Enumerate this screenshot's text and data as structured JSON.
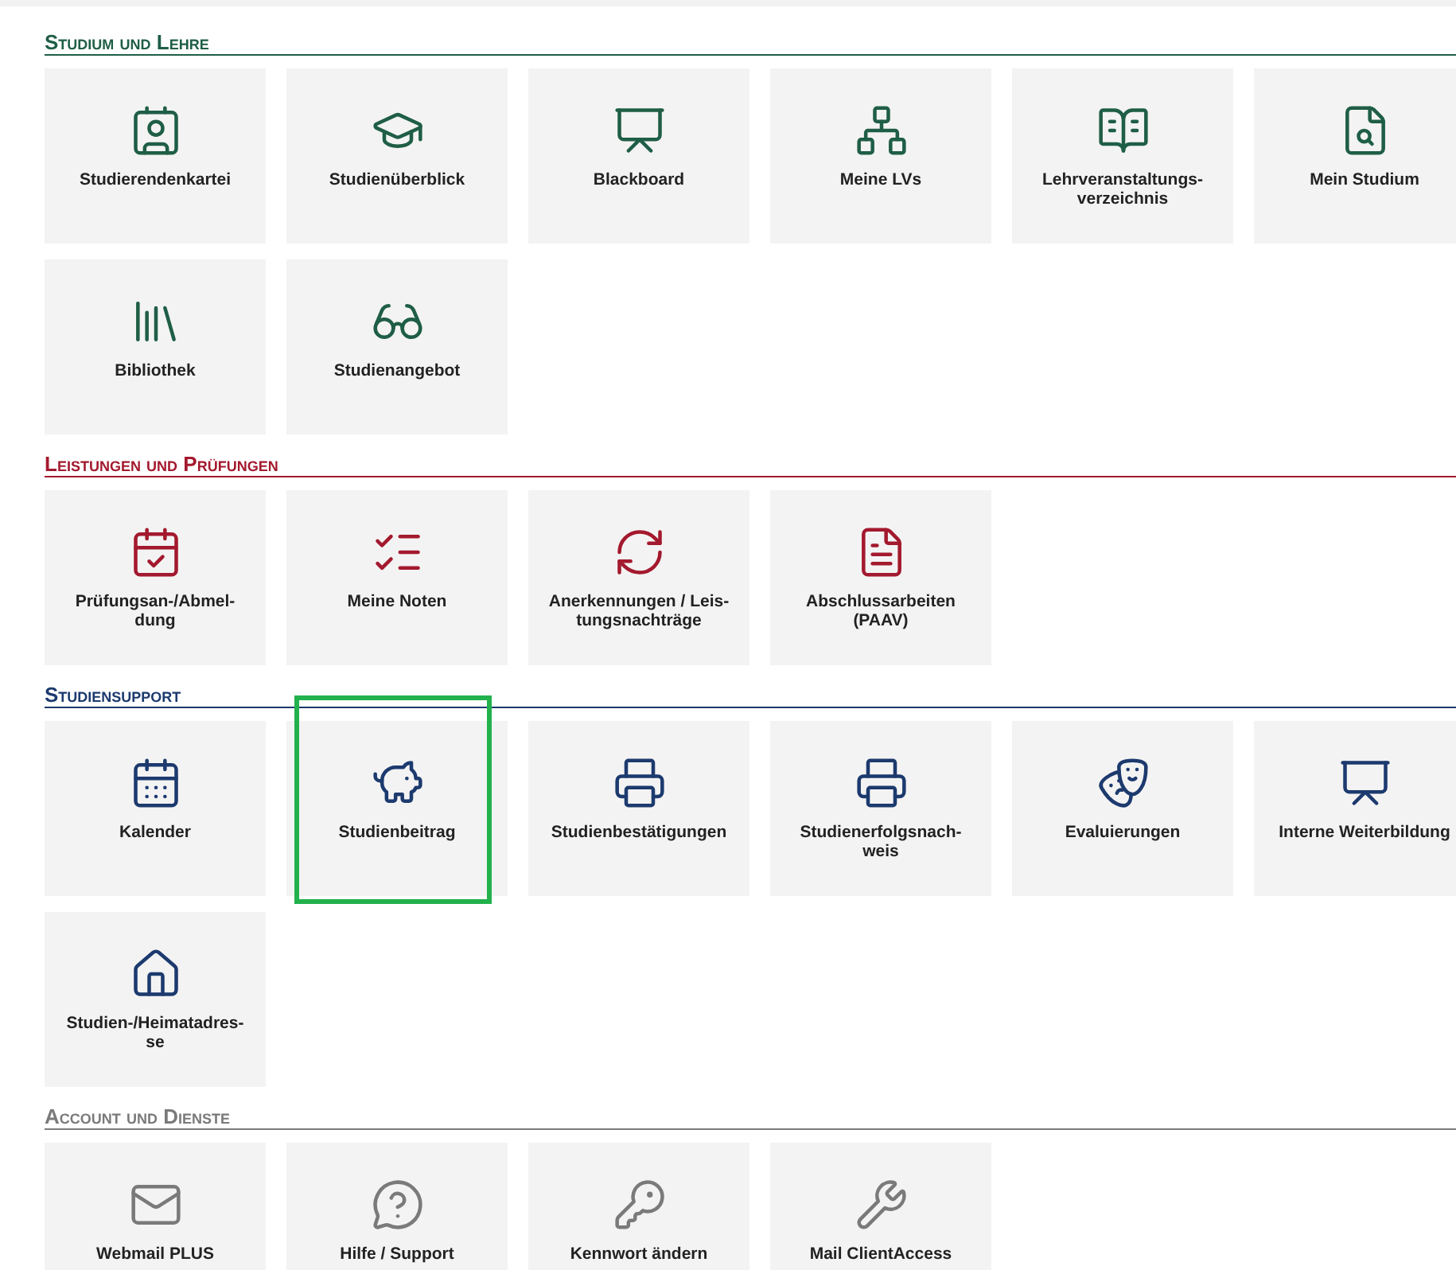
{
  "sections": [
    {
      "title": "Studium und Lehre",
      "color": "#1f5e46",
      "tiles": [
        {
          "label_lines": [
            "Studierendenkartei"
          ],
          "highlighted": false
        },
        {
          "label_lines": [
            "Studienüberblick"
          ],
          "highlighted": false
        },
        {
          "label_lines": [
            "Blackboard"
          ],
          "highlighted": false
        },
        {
          "label_lines": [
            "Meine LVs"
          ],
          "highlighted": false
        },
        {
          "label_lines": [
            "Lehrveranstaltungs-",
            "verzeichnis"
          ],
          "highlighted": false
        },
        {
          "label_lines": [
            "Mein Studium"
          ],
          "highlighted": false
        },
        {
          "label_lines": [
            "Bibliothek"
          ],
          "highlighted": false
        },
        {
          "label_lines": [
            "Studienangebot"
          ],
          "highlighted": false
        }
      ]
    },
    {
      "title": "Leistungen und Prüfungen",
      "color": "#a3192e",
      "tiles": [
        {
          "label_lines": [
            "Prüfungsan-/Abmel-",
            "dung"
          ],
          "highlighted": false
        },
        {
          "label_lines": [
            "Meine Noten"
          ],
          "highlighted": false
        },
        {
          "label_lines": [
            "Anerkennungen / Leis-",
            "tungsnachträge"
          ],
          "highlighted": false
        },
        {
          "label_lines": [
            "Abschlussarbeiten",
            "(PAAV)"
          ],
          "highlighted": false
        }
      ]
    },
    {
      "title": "Studiensupport",
      "color": "#1c3a6e",
      "tiles": [
        {
          "label_lines": [
            "Kalender"
          ],
          "highlighted": false
        },
        {
          "label_lines": [
            "Studienbeitrag"
          ],
          "highlighted": true
        },
        {
          "label_lines": [
            "Studienbestätigungen"
          ],
          "highlighted": false
        },
        {
          "label_lines": [
            "Studienerfolgsnach-",
            "weis"
          ],
          "highlighted": false
        },
        {
          "label_lines": [
            "Evaluierungen"
          ],
          "highlighted": false
        },
        {
          "label_lines": [
            "Interne Weiterbildung"
          ],
          "highlighted": false
        },
        {
          "label_lines": [
            "Studien-/Heimatadres-",
            "se"
          ],
          "highlighted": false
        }
      ]
    },
    {
      "title": "Account und Dienste",
      "color": "#7a7a7a",
      "tiles": [
        {
          "label_lines": [
            "Webmail PLUS"
          ],
          "highlighted": false
        },
        {
          "label_lines": [
            "Hilfe / Support"
          ],
          "highlighted": false
        },
        {
          "label_lines": [
            "Kennwort ändern"
          ],
          "highlighted": false
        },
        {
          "label_lines": [
            "Mail ClientAccess"
          ],
          "highlighted": false
        }
      ]
    }
  ]
}
